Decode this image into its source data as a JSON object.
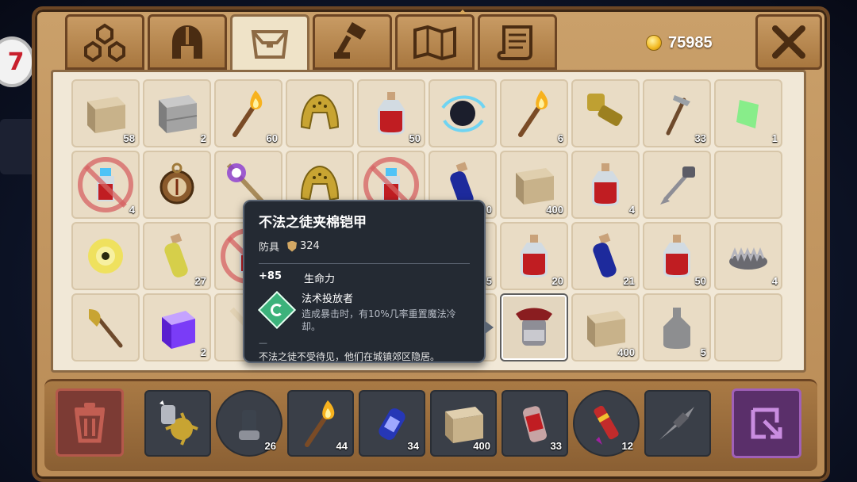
{
  "currency": {
    "icon": "gold-coin-icon",
    "value": "75985"
  },
  "tabs": [
    {
      "icon": "artifact-hierarchy-icon"
    },
    {
      "icon": "helmet-icon"
    },
    {
      "icon": "inventory-bag-icon",
      "active": true
    },
    {
      "icon": "crafting-hammer-icon"
    },
    {
      "icon": "map-book-icon"
    },
    {
      "icon": "scroll-icon"
    }
  ],
  "grid": [
    [
      {
        "item": "sandstone-block",
        "count": "58"
      },
      {
        "item": "stone-block",
        "count": "2"
      },
      {
        "item": "torch",
        "count": "60"
      },
      {
        "item": "gold-helmet",
        "count": ""
      },
      {
        "item": "health-potion",
        "count": "50"
      },
      {
        "item": "swirl-artifact",
        "count": ""
      },
      {
        "item": "torch",
        "count": "6"
      },
      {
        "item": "gold-gauntlet",
        "count": ""
      },
      {
        "item": "pickaxe",
        "count": "33"
      },
      {
        "item": "slime-shard",
        "count": "1"
      }
    ],
    [
      {
        "item": "forbidden-potion",
        "count": "4"
      },
      {
        "item": "compass",
        "count": ""
      },
      {
        "item": "magic-staff",
        "count": ""
      },
      {
        "item": "gold-helmet",
        "count": ""
      },
      {
        "item": "forbidden-potion",
        "count": ""
      },
      {
        "item": "mana-potion",
        "count": "0"
      },
      {
        "item": "sandstone-block",
        "count": "400"
      },
      {
        "item": "health-potion",
        "count": "4"
      },
      {
        "item": "grappling-hook",
        "count": ""
      },
      {
        "item": "empty",
        "count": ""
      }
    ],
    [
      {
        "item": "lightning-orb",
        "count": ""
      },
      {
        "item": "swiftness-potion",
        "count": "27"
      },
      {
        "item": "forbidden-potion",
        "count": ""
      },
      {
        "item": "hidden",
        "count": ""
      },
      {
        "item": "hidden",
        "count": ""
      },
      {
        "item": "hidden",
        "count": "5"
      },
      {
        "item": "health-potion",
        "count": "20"
      },
      {
        "item": "mana-potion",
        "count": "21"
      },
      {
        "item": "health-potion",
        "count": "50"
      },
      {
        "item": "bear-trap",
        "count": "4"
      }
    ],
    [
      {
        "item": "axe",
        "count": ""
      },
      {
        "item": "purple-cube",
        "count": "2"
      },
      {
        "item": "ice-wand",
        "count": ""
      },
      {
        "item": "hidden",
        "count": ""
      },
      {
        "item": "hidden",
        "count": ""
      },
      {
        "item": "hidden",
        "count": ""
      },
      {
        "item": "outlaw-armor",
        "count": "",
        "selected": true
      },
      {
        "item": "sandstone-block",
        "count": "400"
      },
      {
        "item": "ghost-bottle",
        "count": "5"
      },
      {
        "item": "empty",
        "count": ""
      }
    ]
  ],
  "tooltip": {
    "title": "不法之徒夹棉铠甲",
    "type": "防具",
    "power": "324",
    "stat_value": "+85",
    "stat_name": "生命力",
    "enchant_icon": "spellcaster-icon",
    "enchant_name": "法术投放者",
    "enchant_desc": "造成暴击时，有10%几率重置魔法冷却。",
    "dash": "—",
    "lore": "不法之徒不受待见，他们在城镇郊区隐居。"
  },
  "hotbar": [
    {
      "item": "spiked-mace-bomb",
      "count": ""
    },
    {
      "item": "ghost-totem",
      "count": "26"
    },
    {
      "item": "torch",
      "count": "44"
    },
    {
      "item": "blue-canister",
      "count": "34"
    },
    {
      "item": "sandstone-block",
      "count": "400"
    },
    {
      "item": "red-can",
      "count": "33"
    },
    {
      "item": "firework-rocket",
      "count": "12"
    },
    {
      "item": "drill-bit",
      "count": ""
    }
  ],
  "side_badge": "7",
  "colors": {
    "panel": "#b98b56",
    "parchment": "#f1e8d7",
    "tooltip_bg": "#242a33",
    "enchant": "#3cb27b"
  }
}
